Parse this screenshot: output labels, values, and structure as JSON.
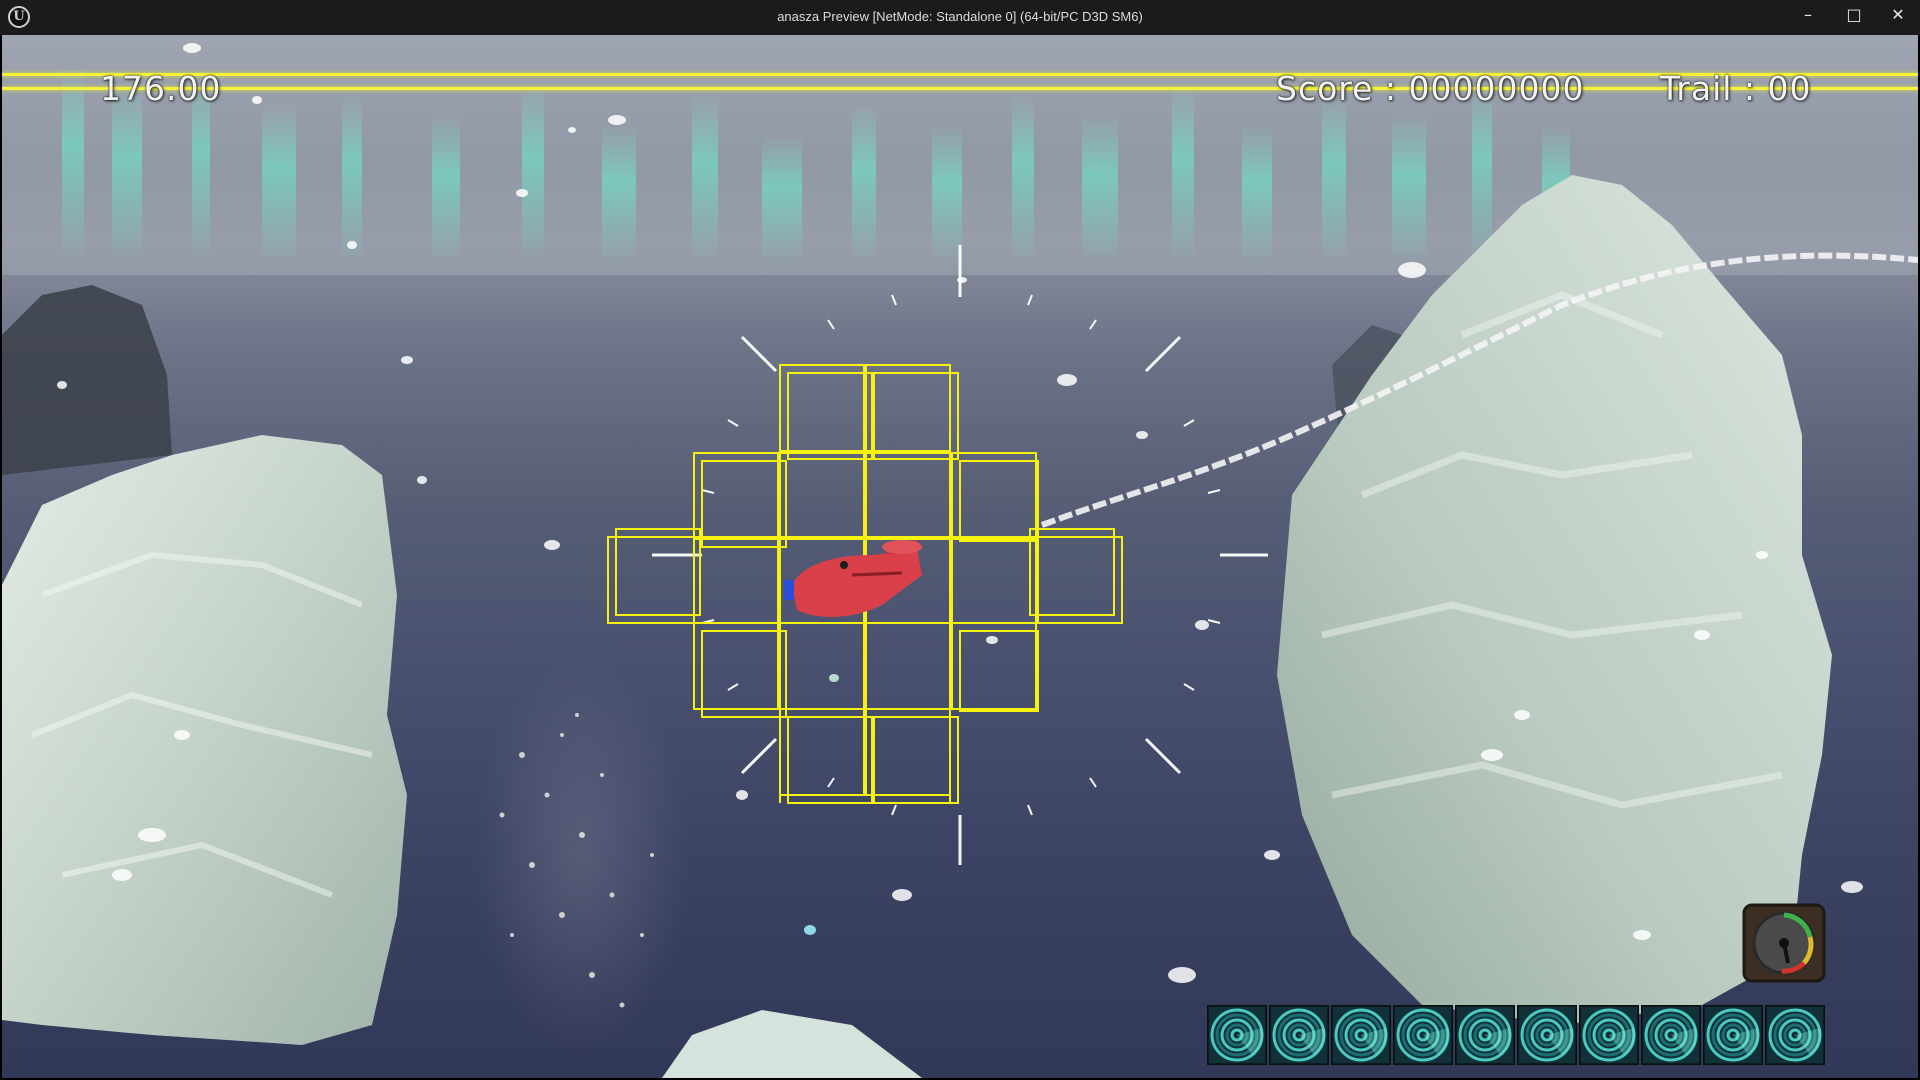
{
  "window": {
    "title": "anasza Preview [NetMode: Standalone 0]  (64-bit/PC D3D SM6)",
    "app_logo": "U",
    "minimize_glyph": "–",
    "maximize_glyph": "□",
    "close_glyph": "✕"
  },
  "hud": {
    "timer": "176.00",
    "score": "Score : 00000000",
    "trail": "Trail : 00",
    "accent_color": "#f4f23a",
    "ability_slot_count": 10
  },
  "icons": {
    "ability_slot": "radar-swirl-icon",
    "speed_gauge": "speedometer-icon",
    "crosshair": "crosshair-reticle"
  }
}
